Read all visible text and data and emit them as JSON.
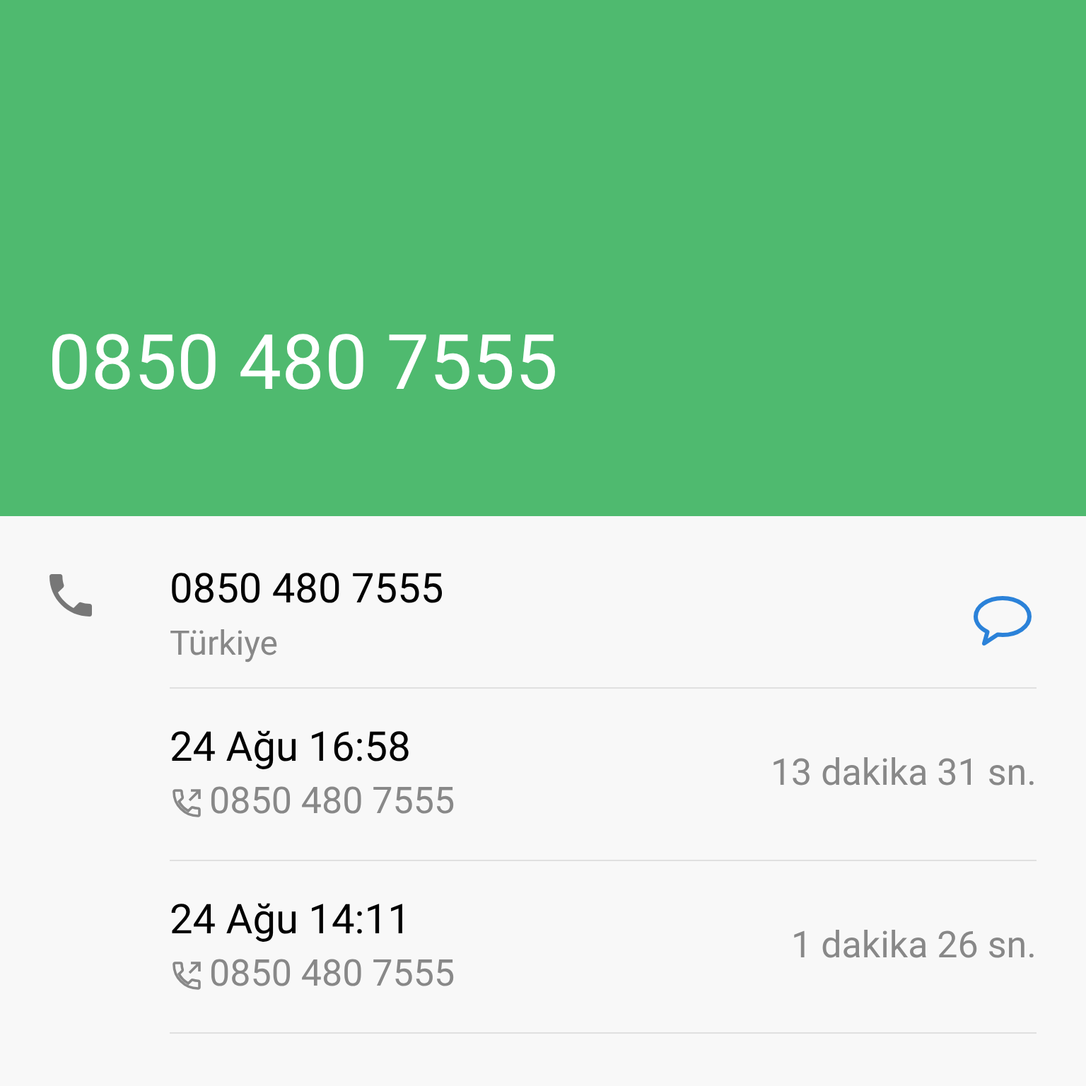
{
  "header": {
    "title": "0850 480 7555"
  },
  "contact": {
    "number": "0850 480 7555",
    "location": "Türkiye"
  },
  "calls": [
    {
      "time": "24 Ağu 16:58",
      "kind": "outgoing",
      "number": "0850 480 7555",
      "duration": "13 dakika 31 sn."
    },
    {
      "time": "24 Ağu 14:11",
      "kind": "outgoing",
      "number": "0850 480 7555",
      "duration": "1 dakika 26 sn."
    }
  ]
}
